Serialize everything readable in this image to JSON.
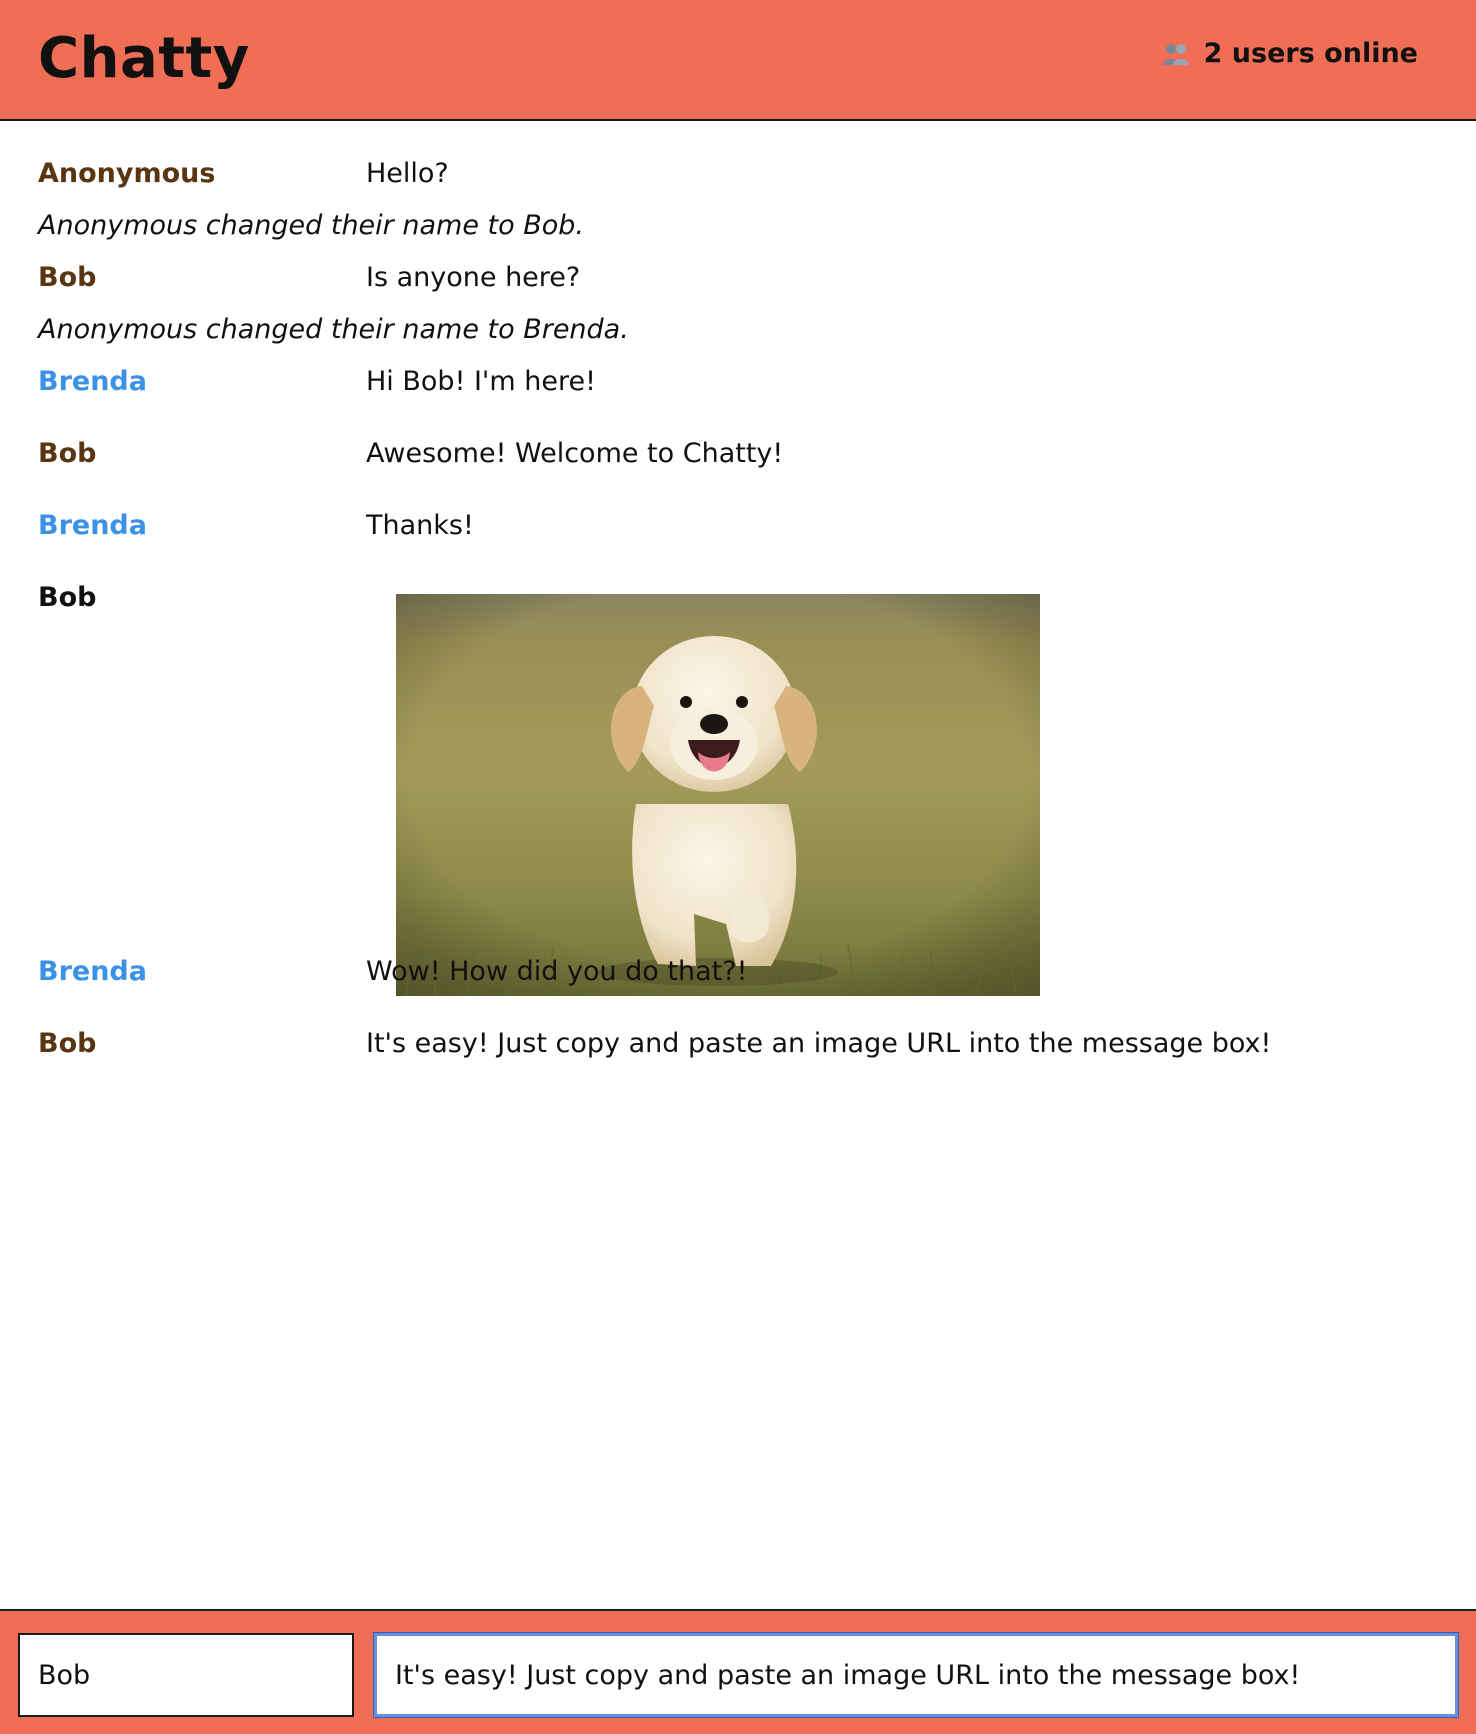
{
  "app": {
    "title": "Chatty",
    "online_count_label": "2 users online",
    "online_icon": "users-icon"
  },
  "messages": [
    {
      "type": "message",
      "user": "Anonymous",
      "content": "Hello?",
      "color": "#5a3511"
    },
    {
      "type": "notification",
      "content": "Anonymous changed their name to Bob."
    },
    {
      "type": "message",
      "user": "Bob",
      "content": "Is anyone here?",
      "color": "#5a3511"
    },
    {
      "type": "notification",
      "content": "Anonymous changed their name to Brenda."
    },
    {
      "type": "message",
      "user": "Brenda",
      "content": "Hi Bob! I'm here!",
      "color": "#3b91e6"
    },
    {
      "type": "message",
      "user": "Bob",
      "content": "Awesome! Welcome to Chatty!",
      "color": "#5a3511"
    },
    {
      "type": "message",
      "user": "Brenda",
      "content": "Thanks!",
      "color": "#3b91e6"
    },
    {
      "type": "image",
      "user": "Bob",
      "image": "puppy-photo",
      "color": "#111111"
    },
    {
      "type": "message",
      "user": "Brenda",
      "content": "Wow! How did you do that?!",
      "color": "#3b91e6"
    },
    {
      "type": "message",
      "user": "Bob",
      "content": "It's easy! Just copy and paste an image URL into the message box!",
      "color": "#5a3511"
    }
  ],
  "composer": {
    "username_value": "Bob",
    "message_value": "It's easy! Just copy and paste an image URL into the message box!"
  },
  "colors": {
    "header": "#f06d56",
    "user_brown": "#5a3511",
    "user_blue": "#3b91e6"
  }
}
